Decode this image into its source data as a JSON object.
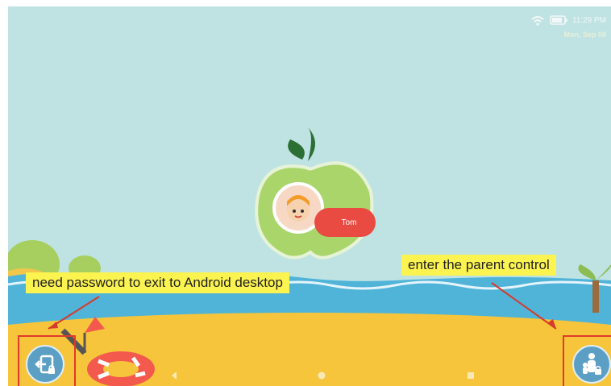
{
  "status_bar": {
    "time": "11:29 PM",
    "date": "Mon, Sep 08"
  },
  "profile": {
    "name": "Tom"
  },
  "annotations": {
    "exit_note": "need password to exit to Android desktop",
    "parent_note": "enter the parent control"
  },
  "icons": {
    "exit": "exit-lock-icon",
    "parent": "parent-lock-icon",
    "wifi": "wifi-icon",
    "battery": "battery-icon",
    "nav_back": "nav-back-icon",
    "nav_home": "nav-home-icon",
    "nav_recent": "nav-recent-icon"
  },
  "colors": {
    "sky": "#bfe3e3",
    "sea": "#4fb4d8",
    "sand": "#f6c53b",
    "apple": "#a9d56a",
    "pill": "#e94a42",
    "annotation_bg": "#fbf34f",
    "highlight": "#e03a2a",
    "button": "#5c9fc5"
  }
}
